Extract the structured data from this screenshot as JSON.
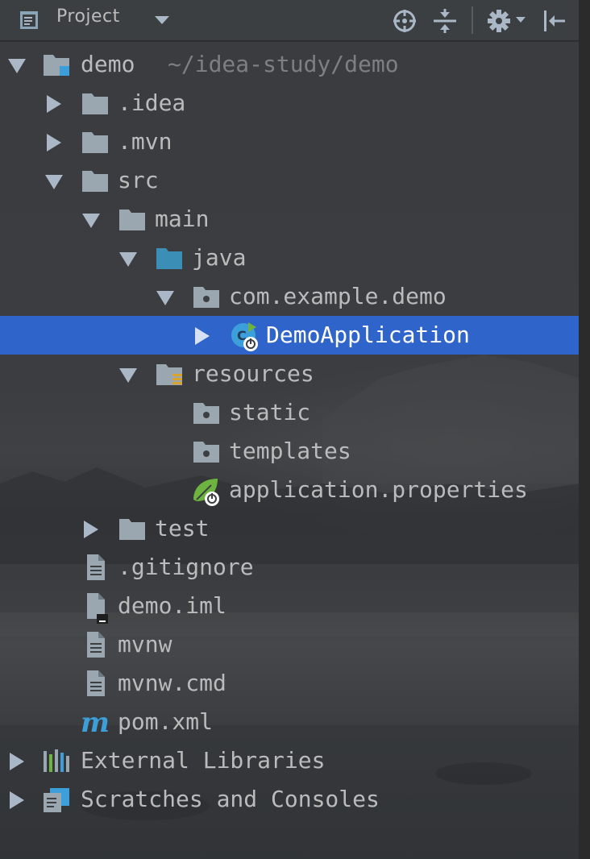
{
  "header": {
    "title": "Project"
  },
  "tree": {
    "root": {
      "label": "demo",
      "path": "~/idea-study/demo"
    },
    "items": [
      {
        "label": ".idea"
      },
      {
        "label": ".mvn"
      },
      {
        "label": "src"
      },
      {
        "label": "main"
      },
      {
        "label": "java"
      },
      {
        "label": "com.example.demo"
      },
      {
        "label": "DemoApplication"
      },
      {
        "label": "resources"
      },
      {
        "label": "static"
      },
      {
        "label": "templates"
      },
      {
        "label": "application.properties"
      },
      {
        "label": "test"
      },
      {
        "label": ".gitignore"
      },
      {
        "label": "demo.iml"
      },
      {
        "label": "mvnw"
      },
      {
        "label": "mvnw.cmd"
      },
      {
        "label": "pom.xml"
      },
      {
        "label": "External Libraries"
      },
      {
        "label": "Scratches and Consoles"
      }
    ]
  },
  "colors": {
    "selection": "#2f65ca",
    "panel": "#3c3f41",
    "text": "#bbbbbb",
    "folder": "#9aa7b0",
    "source_folder": "#3b8fb7",
    "maven": "#3d9fd9",
    "spring": "#6cb33f"
  },
  "icons": {
    "header": [
      "project-view-icon",
      "dropdown-arrow-icon",
      "locate-icon",
      "collapse-all-icon",
      "gear-icon",
      "hide-panel-icon"
    ]
  }
}
